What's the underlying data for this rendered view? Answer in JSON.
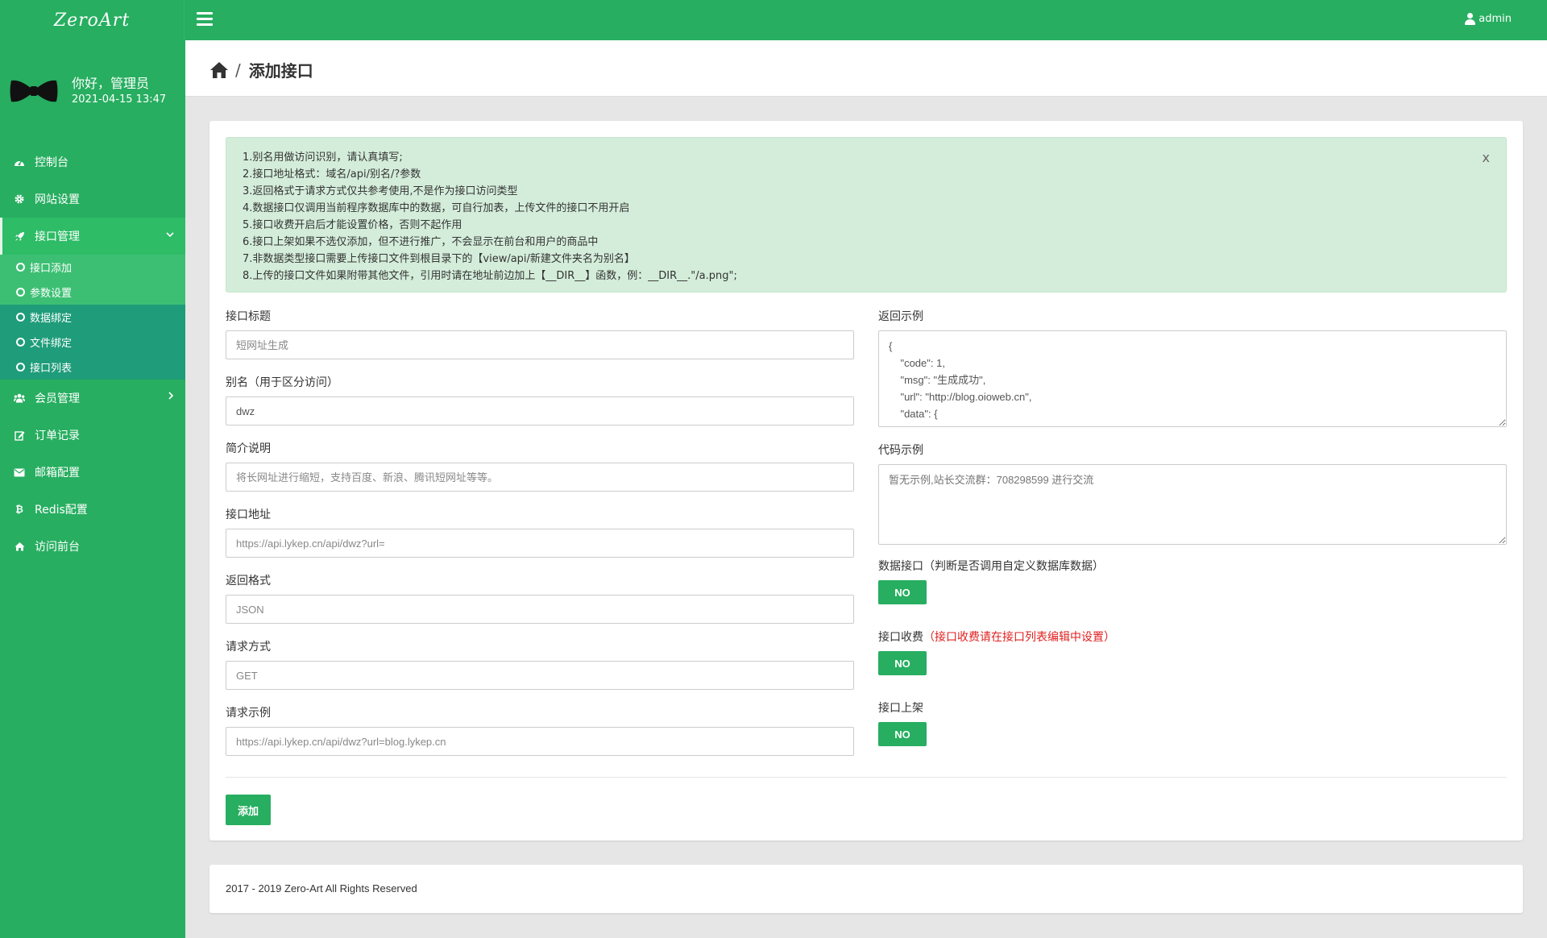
{
  "app": {
    "logo": "ZeroArt",
    "user": "admin"
  },
  "sidebar": {
    "greeting": "你好，管理员",
    "datetime": "2021-04-15 13:47",
    "items": [
      {
        "label": "控制台",
        "icon": "dashboard-icon"
      },
      {
        "label": "网站设置",
        "icon": "gear-icon"
      },
      {
        "label": "接口管理",
        "icon": "rocket-icon"
      },
      {
        "label": "会员管理",
        "icon": "users-icon"
      },
      {
        "label": "订单记录",
        "icon": "edit-icon"
      },
      {
        "label": "邮箱配置",
        "icon": "envelope-icon"
      },
      {
        "label": "Redis配置",
        "icon": "bitcoin-icon"
      },
      {
        "label": "访问前台",
        "icon": "home-icon"
      }
    ],
    "sub_items": [
      {
        "label": "接口添加"
      },
      {
        "label": "参数设置"
      },
      {
        "label": "数据绑定"
      },
      {
        "label": "文件绑定"
      },
      {
        "label": "接口列表"
      }
    ]
  },
  "header": {
    "separator": "/",
    "title": "添加接口"
  },
  "alert": {
    "lines": [
      "1.别名用做访问识别，请认真填写;",
      "2.接口地址格式：域名/api/别名/?参数",
      "3.返回格式于请求方式仅共参考使用,不是作为接口访问类型",
      "4.数据接口仅调用当前程序数据库中的数据，可自行加表，上传文件的接口不用开启",
      "5.接口收费开启后才能设置价格，否则不起作用",
      "6.接口上架如果不选仅添加，但不进行推广，不会显示在前台和用户的商品中",
      "7.非数据类型接口需要上传接口文件到根目录下的【view/api/新建文件夹名为别名】",
      "8.上传的接口文件如果附带其他文件，引用时请在地址前边加上【__DIR__】函数，例：__DIR__.\"/a.png\";"
    ],
    "close": "x"
  },
  "form": {
    "title": {
      "label": "接口标题",
      "placeholder": "短网址生成"
    },
    "alias": {
      "label": "别名（用于区分访问）",
      "value": "dwz"
    },
    "desc": {
      "label": "简介说明",
      "placeholder": "将长网址进行缩短，支持百度、新浪、腾讯短网址等等。"
    },
    "url": {
      "label": "接口地址",
      "placeholder": "https://api.lykep.cn/api/dwz?url="
    },
    "format": {
      "label": "返回格式",
      "placeholder": "JSON"
    },
    "method": {
      "label": "请求方式",
      "placeholder": "GET"
    },
    "example": {
      "label": "请求示例",
      "placeholder": "https://api.lykep.cn/api/dwz?url=blog.lykep.cn"
    },
    "return_example": {
      "label": "返回示例",
      "value": "{\n    \"code\": 1,\n    \"msg\": \"生成成功\",\n    \"url\": \"http://blog.oioweb.cn\",\n    \"data\": {"
    },
    "code_example": {
      "label": "代码示例",
      "placeholder": "暂无示例,站长交流群：708298599 进行交流"
    },
    "data_api": {
      "label": "数据接口（判断是否调用自定义数据库数据）",
      "toggle": "NO"
    },
    "charge": {
      "label": "接口收费",
      "note": "（接口收费请在接口列表编辑中设置）",
      "toggle": "NO"
    },
    "publish": {
      "label": "接口上架",
      "toggle": "NO"
    },
    "submit": "添加"
  },
  "footer": {
    "text": "2017 - 2019 Zero-Art All Rights Reserved"
  },
  "colors": {
    "primary": "#27ae60",
    "submenu": "#1f9c7a",
    "alert_bg": "#d4edda",
    "note_red": "#e02020"
  }
}
